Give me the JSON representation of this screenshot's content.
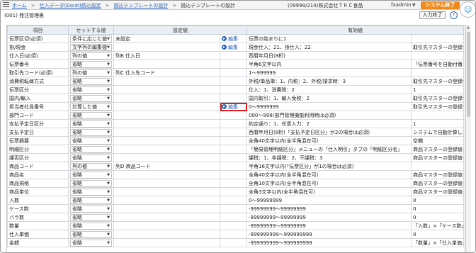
{
  "topbar": {
    "breadcrumb": [
      "ホーム",
      "仕入データ(Excel)読込設定",
      "読込テンプレートの設計",
      "読込テンプレートの設計"
    ],
    "company": "(09999/214)株式会社ＴＫＣ食品",
    "user": "fxadmin",
    "exit_label": "システム終了"
  },
  "subbar": {
    "title": "(001) 発注管理表",
    "finish_label": "入力終了",
    "help_label": "?"
  },
  "table": {
    "headers": [
      "項目",
      "セットする値",
      "設定値",
      "",
      "有効値",
      ""
    ],
    "edit_label": "編集",
    "rows": [
      {
        "item": "伝票区切(必須)",
        "set": "条件に応じた値",
        "value": "未設定",
        "edit": true,
        "valid": "伝票の始まりに1",
        "extra": ""
      },
      {
        "item": "掛/現金",
        "set": "文字列の編集値",
        "value": "",
        "edit": true,
        "valid": "現金仕入：21、掛仕入：22",
        "extra": "取引先マスターの登録値"
      },
      {
        "item": "仕入日(必須)",
        "set": "列の値",
        "value": "列B 仕入日",
        "edit": false,
        "valid": "西暦年月日(8桁)",
        "extra": ""
      },
      {
        "item": "伝票番号",
        "set": "省略",
        "value": "",
        "edit": false,
        "valid": "半角6文字以内",
        "extra": "「伝票番号を自動付番"
      },
      {
        "item": "取引先コード(必須)",
        "set": "列の値",
        "value": "列C 仕入先コード",
        "edit": false,
        "valid": "1〜999999",
        "extra": ""
      },
      {
        "item": "消費税転嫁方式",
        "set": "省略",
        "value": "",
        "edit": false,
        "valid": "外税/単品単：1、内税：2、外税/請求時：3",
        "extra": "取引先マスターの登録値"
      },
      {
        "item": "伝票区分",
        "set": "省略",
        "value": "",
        "edit": false,
        "valid": "仕入：1、消費税：2",
        "extra": "1"
      },
      {
        "item": "国内/輸入",
        "set": "省略",
        "value": "",
        "edit": false,
        "valid": "国内取引：1、輸入免税：2",
        "extra": "取引先マスターの登録値"
      },
      {
        "item": "担当者社員番号",
        "set": "計算した値",
        "value": "",
        "edit": true,
        "highlight": true,
        "valid": "0〜9999999",
        "extra": "取引先マスターの登録値"
      },
      {
        "item": "部門コード",
        "set": "省略",
        "value": "",
        "edit": false,
        "valid": "000〜998(部門管理機能利用時は必須)",
        "extra": ""
      },
      {
        "item": "支払予定日区分",
        "set": "省略",
        "value": "",
        "edit": false,
        "valid": "約定通り：1、任意入力：2",
        "extra": "1"
      },
      {
        "item": "支払予定日",
        "set": "省略",
        "value": "",
        "edit": false,
        "valid": "西暦年月日(8桁)「支払予定日区分」が2の場合は必須)",
        "extra": "システムで自動計算した"
      },
      {
        "item": "伝票摘要",
        "set": "省略",
        "value": "",
        "edit": false,
        "valid": "全角40文字以内(全半角混在可)",
        "extra": "空欄"
      },
      {
        "item": "明細区分",
        "set": "省略",
        "value": "",
        "edit": false,
        "valid": "「簡易管理明細区分」メニューの「仕入明引」タブの「明細区分名」",
        "extra": "商品マスターの登録値"
      },
      {
        "item": "課否区分",
        "set": "省略",
        "value": "",
        "edit": false,
        "valid": "課税：1、非課税：2、不課税：3",
        "extra": "商品マスターの登録値"
      },
      {
        "item": "商品コード",
        "set": "列の値",
        "value": "列D 商品コード",
        "edit": false,
        "valid": "半角16文字以内(「伝票区分」が1の場合は必須)",
        "extra": ""
      },
      {
        "item": "商品名",
        "set": "省略",
        "value": "",
        "edit": false,
        "valid": "全角40文字以内(全半角混在可)",
        "extra": "商品マスターの登録値"
      },
      {
        "item": "商品規格",
        "set": "省略",
        "value": "",
        "edit": false,
        "valid": "全角10文字以内(全半角混在可)",
        "extra": "商品マスターの登録値"
      },
      {
        "item": "商品単位",
        "set": "省略",
        "value": "",
        "edit": false,
        "valid": "全角3文字以内(全半角混在可)",
        "extra": "商品マスターの登録値"
      },
      {
        "item": "入数",
        "set": "省略",
        "value": "",
        "edit": false,
        "valid": "0〜99999999",
        "extra": "0"
      },
      {
        "item": "ケース数",
        "set": "省略",
        "value": "",
        "edit": false,
        "valid": "-99999999〜99999999",
        "extra": "0"
      },
      {
        "item": "バラ数",
        "set": "省略",
        "value": "",
        "edit": false,
        "valid": "-99999999〜99999999",
        "extra": "0"
      },
      {
        "item": "数量",
        "set": "省略",
        "value": "",
        "edit": false,
        "valid": "-99999999〜99999999",
        "extra": "「入数」×「ケース数」-"
      },
      {
        "item": "仕入単価",
        "set": "省略",
        "value": "",
        "edit": false,
        "valid": "-999999999〜999999999",
        "extra": "0"
      },
      {
        "item": "金額",
        "set": "省略",
        "value": "",
        "edit": false,
        "valid": "-999999999〜999999999",
        "extra": "「数量」×「仕入単価」"
      }
    ]
  }
}
